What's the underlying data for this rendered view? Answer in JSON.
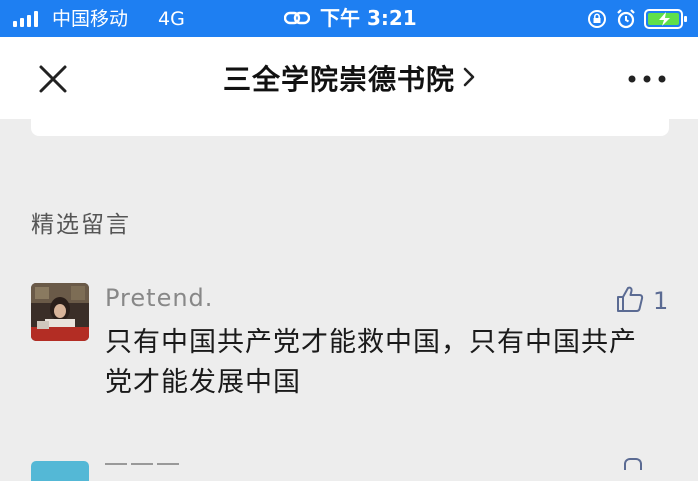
{
  "status_bar": {
    "carrier": "中国移动",
    "network": "4G",
    "time": "下午 3:21"
  },
  "nav": {
    "title": "三全学院崇德书院",
    "icons": [
      "close-icon",
      "chevron-right-icon",
      "more-icon"
    ]
  },
  "section": {
    "title": "精选留言"
  },
  "comments": [
    {
      "user": "Pretend.",
      "likes": "1",
      "text": "只有中国共产党才能救中国，只有中国共产党才能发展中国"
    }
  ],
  "colors": {
    "status_bar": "#1e7ff2",
    "background": "#ededed",
    "like_accent": "#5b6b93"
  }
}
